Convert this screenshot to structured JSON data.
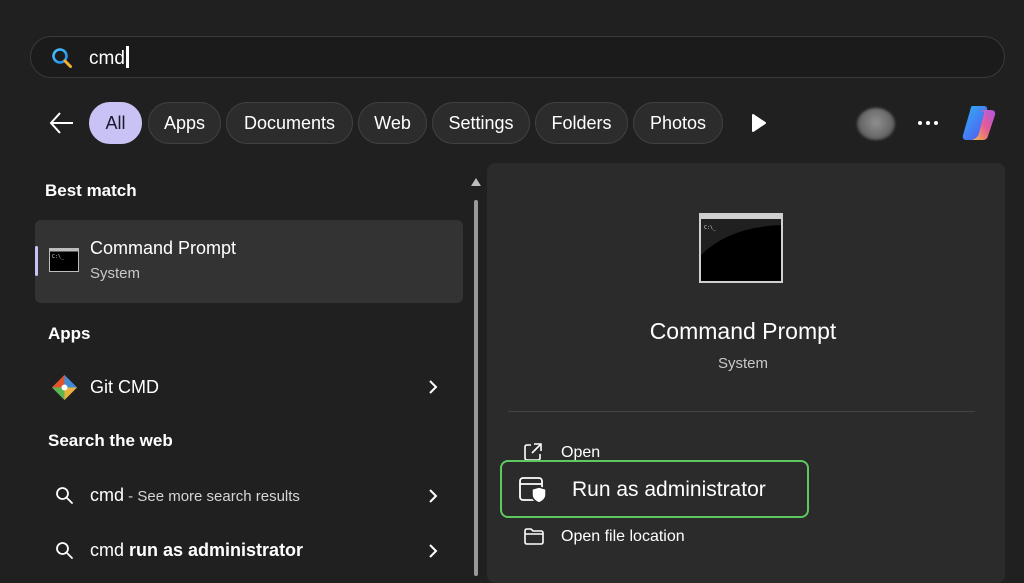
{
  "search": {
    "query": "cmd"
  },
  "filters": [
    "All",
    "Apps",
    "Documents",
    "Web",
    "Settings",
    "Folders",
    "Photos"
  ],
  "best_match": {
    "section": "Best match",
    "title": "Command Prompt",
    "subtitle": "System"
  },
  "apps": {
    "section": "Apps",
    "items": [
      {
        "label": "Git CMD"
      }
    ]
  },
  "web": {
    "section": "Search the web",
    "items": [
      {
        "bold": "cmd",
        "rest": " - See more search results"
      },
      {
        "bold": "cmd",
        "rest": " run as administrator"
      }
    ]
  },
  "details": {
    "title": "Command Prompt",
    "subtitle": "System",
    "actions": [
      {
        "label": "Open",
        "icon": "open-external-icon"
      },
      {
        "label": "Run as administrator",
        "icon": "shield-window-icon",
        "highlighted": true
      },
      {
        "label": "Open file location",
        "icon": "folder-icon"
      }
    ]
  },
  "colors": {
    "background": "#202020",
    "active_chip": "#c8c3f4",
    "highlight_border": "#5ec95e",
    "search_icon": "#4cc2ff"
  }
}
